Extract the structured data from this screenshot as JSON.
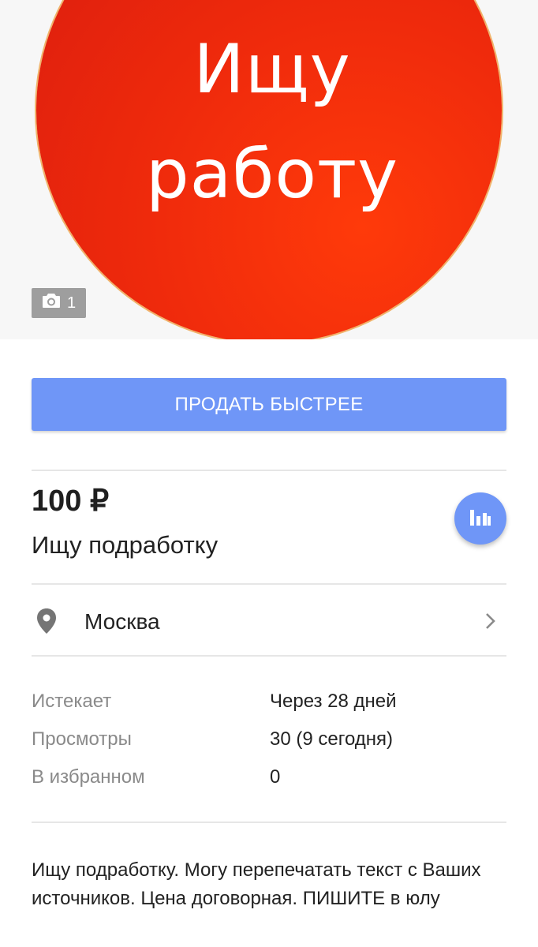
{
  "hero": {
    "line1": "Ищу",
    "line2": "работу",
    "photo_count": "1",
    "photo_icon": "camera-icon"
  },
  "sell_button": {
    "label": "ПРОДАТЬ БЫСТРЕЕ"
  },
  "listing": {
    "price": "100 ₽",
    "title": "Ищу подработку",
    "stats_icon": "bar-chart-icon"
  },
  "location": {
    "city": "Москва",
    "icon": "location-pin-icon",
    "chevron_icon": "chevron-right-icon"
  },
  "info": [
    {
      "label": "Истекает",
      "value": "Через 28 дней"
    },
    {
      "label": "Просмотры",
      "value": "30 (9 сегодня)"
    },
    {
      "label": "В избранном",
      "value": "0"
    }
  ],
  "description": "Ищу подработку. Могу перепечатать текст с Ваших источников. Цена договорная. ПИШИТЕ в юлу",
  "colors": {
    "accent": "#6f96f7",
    "hero_red": "#e8250d",
    "divider": "#e6e6e6",
    "label_gray": "#8a8a8a"
  }
}
